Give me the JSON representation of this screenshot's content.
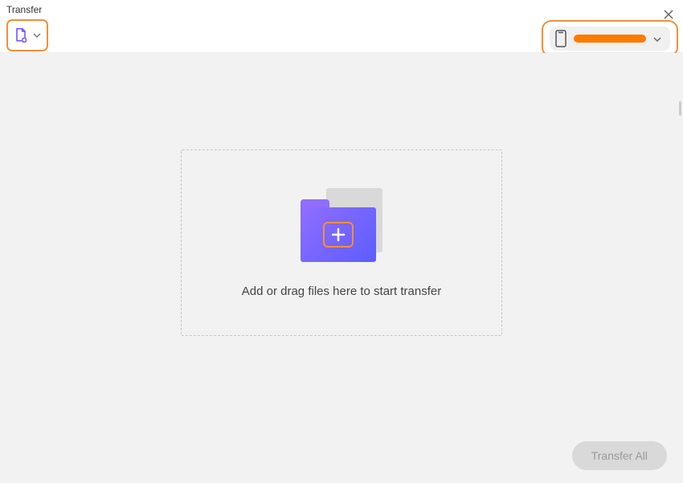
{
  "window": {
    "title": "Transfer"
  },
  "toolbar": {
    "add_file_icon": "document-add-icon",
    "device_selected_label": "",
    "dropdown_icon": "chevron-down-icon"
  },
  "dropzone": {
    "hint": "Add or drag files here to start transfer",
    "folder_icon": "folder-add-icon"
  },
  "footer": {
    "transfer_all_label": "Transfer All"
  },
  "colors": {
    "accent_orange": "#f0913b",
    "brand_purple": "#7a56ff",
    "bg_content": "#f2f2f2",
    "disabled": "#d9d9d9"
  }
}
